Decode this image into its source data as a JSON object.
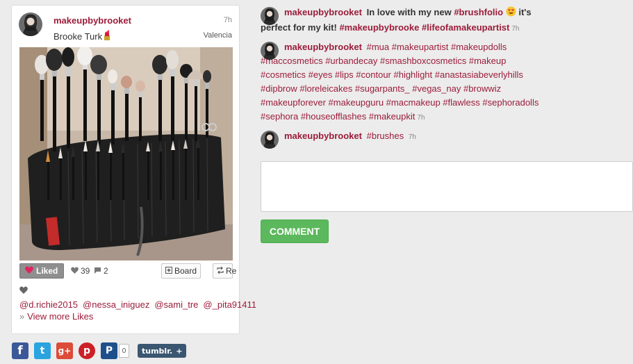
{
  "post": {
    "username": "makeupbybrooket",
    "time": "7h",
    "full_name": "Brooke Turk",
    "location": "Valencia",
    "image_icon": "makeup-brushes-photo",
    "liked_label": "Liked",
    "likes_count": "39",
    "comments_count": "2",
    "board_label": "Board",
    "repost_label": "Re",
    "likers": [
      "@d.richie2015",
      "@nessa_iniguez",
      "@sami_tre",
      "@_pita91411"
    ],
    "view_more": "View more Likes"
  },
  "share": {
    "facebook_icon": "f",
    "twitter_icon": "t",
    "googleplus_icon": "g+",
    "pinterest_icon": "p",
    "publicize_icon": "P",
    "publicize_count": "0",
    "tumblr_label": "tumblr.",
    "tumblr_plus": "+"
  },
  "comments": [
    {
      "username": "makeupbybrooket",
      "text_1": "In love with my new",
      "tag_1": "#brushfolio",
      "text_2": "it's",
      "text_3": "perfect for my kit!",
      "tag_2": "#makeupbybrooke",
      "tag_3": "#lifeofamakeupartist",
      "time": "7h"
    },
    {
      "username": "makeupbybrooket",
      "line_1": "#mua #makeupartist #makeupdolls",
      "line_2": "#maccosmetics #urbandecay #smashboxcosmetics #makeup",
      "line_3": "#cosmetics #eyes #lips #contour #highlight #anastasiabeverlyhills",
      "line_4": "#dipbrow #loreleicakes #sugarpants_ #vegas_nay #browwiz",
      "line_5": "#makeupforever #makeupguru #macmakeup #flawless #sephoradolls",
      "line_6": "#sephora #houseofflashes #makeupkit",
      "time": "7h"
    },
    {
      "username": "makeupbybrooket",
      "tag": "#brushes",
      "time": "7h"
    }
  ],
  "comment_form": {
    "placeholder": "",
    "button_label": "COMMENT"
  },
  "colors": {
    "accent": "#9b1c3a",
    "comment_button": "#5cb85c",
    "liked_button": "#8f8f8f"
  }
}
